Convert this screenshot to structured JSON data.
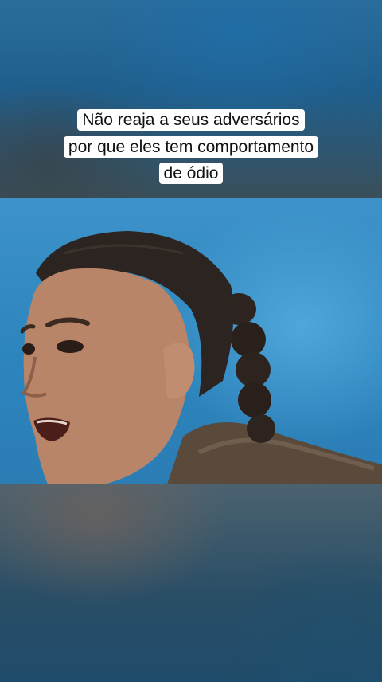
{
  "caption": {
    "line1": "Não reaja a seus adversários",
    "line2": "por que eles tem comportamento",
    "line3": "de ódio"
  },
  "colors": {
    "caption_bg": "#ffffff",
    "caption_text": "#111111",
    "stage_blue": "#2d85bd"
  }
}
